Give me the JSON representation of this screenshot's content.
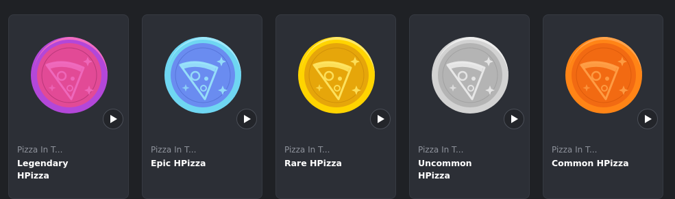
{
  "nfts": [
    {
      "collection": "Pizza In T...",
      "name": "Legendary HPizza",
      "rarity": "legendary",
      "colors": {
        "inner": "#e24a96",
        "rim": "#b347d9",
        "rim_light": "#f06cc0",
        "dark": "#a8306e"
      },
      "icon": "pizza-coin-icon",
      "action_icon": "play-icon"
    },
    {
      "collection": "Pizza In T...",
      "name": "Epic HPizza",
      "rarity": "epic",
      "colors": {
        "inner": "#6a8cf0",
        "rim": "#6fd6f2",
        "rim_light": "#9be7fa",
        "dark": "#4e6bcf"
      },
      "icon": "pizza-coin-icon",
      "action_icon": "play-icon"
    },
    {
      "collection": "Pizza In T...",
      "name": "Rare HPizza",
      "rarity": "rare",
      "colors": {
        "inner": "#e6a60a",
        "rim": "#ffd400",
        "rim_light": "#ffe866",
        "dark": "#c88808"
      },
      "icon": "pizza-coin-icon",
      "action_icon": "play-icon"
    },
    {
      "collection": "Pizza In T...",
      "name": "Uncommon HPizza",
      "rarity": "uncommon",
      "colors": {
        "inner": "#b4b4b4",
        "rim": "#d2d2d2",
        "rim_light": "#ececec",
        "dark": "#999999"
      },
      "icon": "pizza-coin-icon",
      "action_icon": "play-icon"
    },
    {
      "collection": "Pizza In T...",
      "name": "Common HPizza",
      "rarity": "common",
      "colors": {
        "inner": "#f26a12",
        "rim": "#ff8416",
        "rim_light": "#ffa24a",
        "dark": "#d4560a"
      },
      "icon": "pizza-coin-icon",
      "action_icon": "play-icon"
    }
  ]
}
